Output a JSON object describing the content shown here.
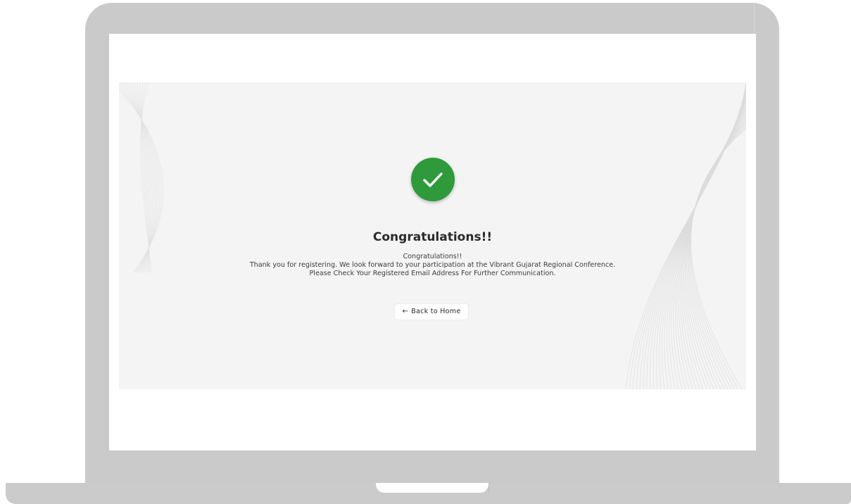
{
  "confirmation": {
    "title": "Congratulations!!",
    "message_lines": [
      "Congratulations!!",
      "Thank you for registering. We look forward to your participation at the Vibrant Gujarat Regional Conference.",
      "Please Check Your Registered Email Address For Further Communication."
    ],
    "back_button": {
      "arrow": "←",
      "label": "Back to Home"
    },
    "success_icon": "check-icon"
  },
  "colors": {
    "success": "#2f9a3b",
    "panel_background": "#f4f4f4",
    "device_frame": "#cacaca",
    "text": "#2a2a2a"
  }
}
